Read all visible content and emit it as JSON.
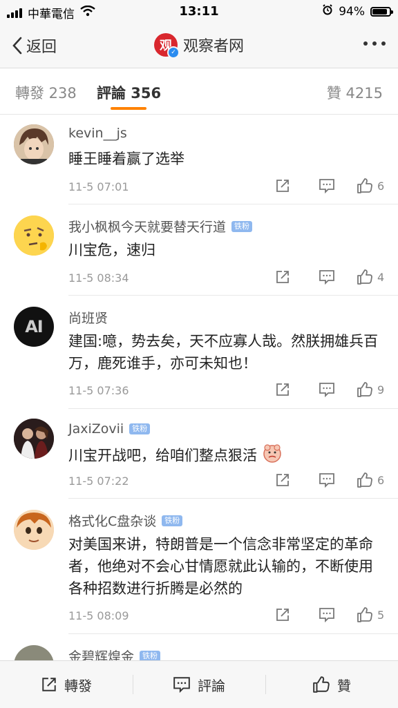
{
  "status": {
    "carrier": "中華電信",
    "time": "13:11",
    "battery": "94%",
    "battery_level": 0.94
  },
  "nav": {
    "back_label": "返回",
    "logo_text": "观",
    "title": "观察者网"
  },
  "tabs": [
    {
      "label": "轉發 238"
    },
    {
      "label": "評論 356"
    },
    {
      "label": "贊 4215"
    }
  ],
  "comments": [
    {
      "name": "kevin__js",
      "badge": "",
      "text": "睡王睡着赢了选举",
      "time": "11-5 07:01",
      "likes": "6"
    },
    {
      "name": "我小枫枫今天就要替天行道",
      "badge": "铁粉",
      "text": "川宝危，速归",
      "time": "11-5 08:34",
      "likes": "4"
    },
    {
      "name": "尚班贤",
      "badge": "",
      "avatar_text": "AI",
      "text": "建国:噫，势去矣，天不应寡人哉。然朕拥雄兵百万，鹿死谁手，亦可未知也！",
      "time": "11-5 07:36",
      "likes": "9"
    },
    {
      "name": "JaxiZovii",
      "badge": "铁粉",
      "text": "川宝开战吧，给咱们整点狠活",
      "time": "11-5 07:22",
      "likes": "6"
    },
    {
      "name": "格式化C盘杂谈",
      "badge": "铁粉",
      "text": "对美国来讲，特朗普是一个信念非常坚定的革命者，他绝对不会心甘情愿就此认输的，不断使用各种招数进行折腾是必然的",
      "time": "11-5 08:09",
      "likes": "5"
    },
    {
      "name": "金碧辉煌金",
      "badge": "铁粉"
    }
  ],
  "bottom": {
    "repost": "轉發",
    "comment": "評論",
    "like": "贊"
  }
}
